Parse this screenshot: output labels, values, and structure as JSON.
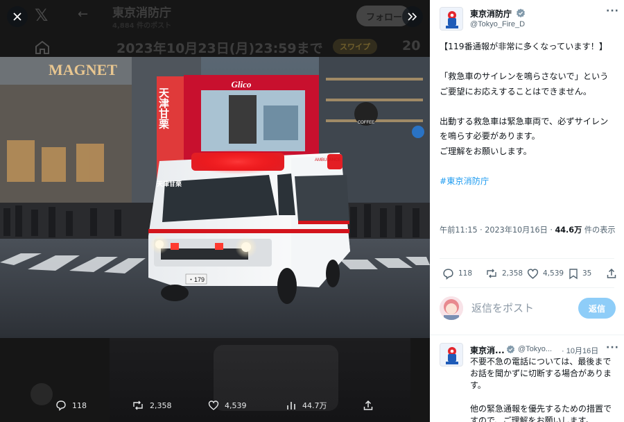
{
  "viewer": {
    "close_label": "×",
    "background": {
      "account_name": "東京消防庁",
      "account_sub": "4,884 件のポスト",
      "banner_text": "2023年10月23日(月)23:59まで",
      "swipe_badge": "スワイプ",
      "banner_number": "20",
      "follow_label": "フォロー"
    },
    "photo_signs": {
      "store_sign": "MAGNET",
      "billboard_vertical": "天津甘栗",
      "billboard_top": "Glico",
      "coffee_sign": "COFFEE",
      "shop_sign": "天津甘栗",
      "plate_number": "・179",
      "ambulance_label": "AMBULANCE"
    },
    "actions": {
      "replies": "118",
      "reposts": "2,358",
      "likes": "4,539",
      "views": "44.7万"
    }
  },
  "tweet": {
    "author_name": "東京消防庁",
    "author_handle": "@Tokyo_Fire_D",
    "more_label": "···",
    "lines": [
      "【119番通報が非常に多くなっています！】",
      "「救急車のサイレンを鳴らさないで」というご要望にお応えすることはできません。",
      "出動する救急車は緊急車両で、必ずサイレンを鳴らす必要があります。",
      "ご理解をお願いします。"
    ],
    "hashtag": "#東京消防庁",
    "timestamp": "午前11:15 · 2023年10月16日 · ",
    "views_count": "44.6万",
    "views_suffix": " 件の表示",
    "stats": {
      "replies": "118",
      "reposts": "2,358",
      "likes": "4,539",
      "bookmarks": "35"
    }
  },
  "reply_composer": {
    "placeholder": "返信をポスト",
    "button_label": "返信"
  },
  "reply_tweet": {
    "author_name": "東京消...",
    "author_handle": "@Tokyo...",
    "date": "· 10月16日",
    "more_label": "···",
    "paragraph1": "不要不急の電話については、最後までお話を聞かずに切断する場合があります。",
    "paragraph2": "他の緊急通報を優先するための措置ですので、ご理解をお願いします。"
  },
  "colors": {
    "accent_blue": "#1d9bf0",
    "reply_button": "#8ecdf8",
    "verified_badge": "#829aab",
    "ambulance_red": "#d3141c"
  }
}
